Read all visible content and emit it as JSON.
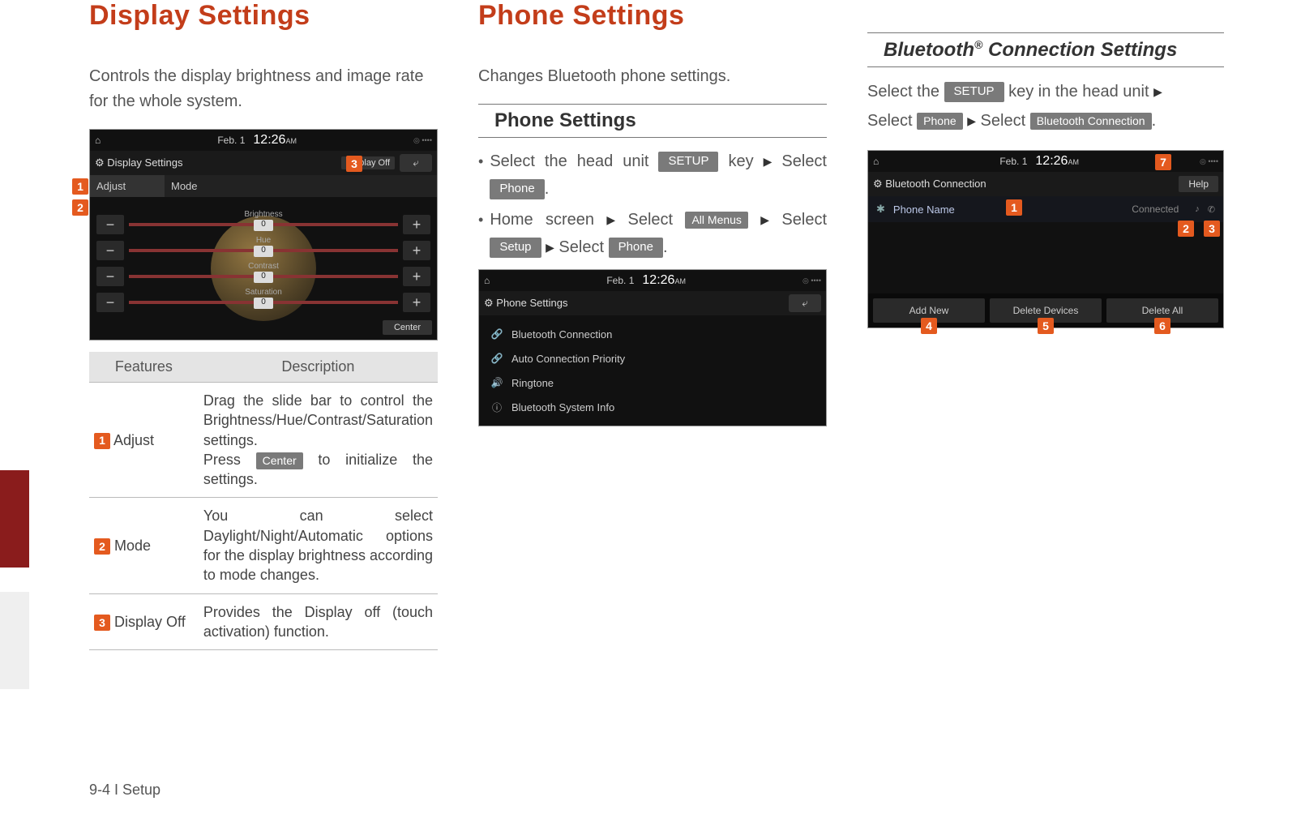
{
  "display": {
    "heading": "Display Settings",
    "intro": "Controls the display brightness and image rate for the whole system.",
    "screenshot": {
      "date": "Feb. 1",
      "time": "12:26",
      "ampm": "AM",
      "title": "Display Settings",
      "display_off": "Display Off",
      "tab_adjust": "Adjust",
      "tab_mode": "Mode",
      "sliders": [
        "Brightness",
        "Hue",
        "Contrast",
        "Saturation"
      ],
      "slider_val": "0",
      "center": "Center"
    },
    "table": {
      "h1": "Features",
      "h2": "Description",
      "rows": [
        {
          "n": "1",
          "name": "Adjust",
          "desc_a": "Drag the slide bar to control the Brightness/Hue/Contrast/Saturation settings.",
          "desc_b1": "Press ",
          "btn": "Center",
          "desc_b2": " to initialize the settings."
        },
        {
          "n": "2",
          "name": "Mode",
          "desc": "You can select Daylight/Night/Automatic options for the display brightness according to mode changes."
        },
        {
          "n": "3",
          "name": "Display Off",
          "desc": "Provides the Display off (touch activation) function."
        }
      ]
    }
  },
  "phone": {
    "heading": "Phone Settings",
    "intro": "Changes Bluetooth phone settings.",
    "sub": "Phone Settings",
    "b1": {
      "a": "Select the head unit ",
      "btn1": "SETUP",
      "b": " key ",
      "c": "Select ",
      "btn2": "Phone",
      "d": "."
    },
    "b2": {
      "a": "Home screen ",
      "b": " Select ",
      "btn1": "All Menus",
      "c": "Select ",
      "btn2": "Setup",
      "d": " Select ",
      "btn3": "Phone",
      "e": "."
    },
    "screenshot": {
      "date": "Feb. 1",
      "time": "12:26",
      "ampm": "AM",
      "title": "Phone Settings",
      "items": [
        {
          "icon": "link",
          "label": "Bluetooth Connection"
        },
        {
          "icon": "link",
          "label": "Auto Connection Priority"
        },
        {
          "icon": "sound",
          "label": "Ringtone"
        },
        {
          "icon": "info",
          "label": "Bluetooth System Info"
        }
      ]
    }
  },
  "bt": {
    "heading_a": "Bluetooth",
    "heading_b": " Connection Settings",
    "line1_a": "Select the ",
    "line1_btn": "SETUP",
    "line1_b": " key in the head unit ",
    "line2_a": "Select ",
    "line2_btn1": "Phone",
    "line2_b": "  Select ",
    "line2_btn2": "Bluetooth Connection",
    "line2_c": ".",
    "screenshot": {
      "date": "Feb. 1",
      "time": "12:26",
      "ampm": "AM",
      "title": "Bluetooth Connection",
      "help": "Help",
      "row_name": "Phone Name",
      "row_conn": "Connected",
      "btns": [
        "Add New",
        "Delete Devices",
        "Delete All"
      ]
    }
  },
  "footnote": "9-4 I Setup"
}
